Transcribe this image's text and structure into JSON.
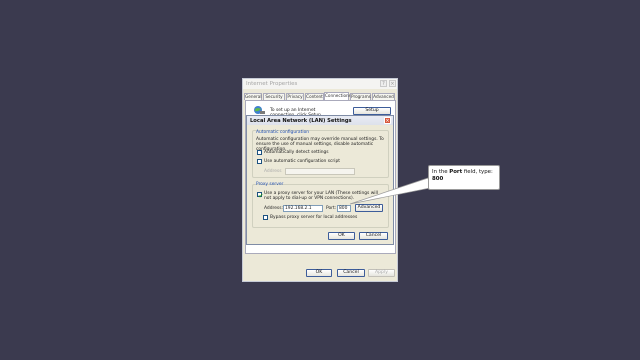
{
  "internet_properties": {
    "title": "Internet Properties",
    "tabs": [
      "General",
      "Security",
      "Privacy",
      "Content",
      "Connections",
      "Programs",
      "Advanced"
    ],
    "active_tab": "Connections",
    "setup_text": "To set up an Internet connection, click Setup.",
    "setup_button": "Setup",
    "ok": "OK",
    "cancel": "Cancel",
    "apply": "Apply",
    "help_glyph": "?",
    "close_glyph": "×"
  },
  "lan_dialog": {
    "title": "Local Area Network (LAN) Settings",
    "auto_config": {
      "label": "Automatic configuration",
      "description": "Automatic configuration may override manual settings. To ensure the use of manual settings, disable automatic configuration.",
      "auto_detect": "Automatically detect settings",
      "use_script": "Use automatic configuration script",
      "address_label": "Address"
    },
    "proxy": {
      "label": "Proxy server",
      "use_proxy": "Use a proxy server for your LAN (These settings will not apply to dial-up or VPN connections).",
      "address_label": "Address:",
      "address_value": "192.168.2.1",
      "port_label": "Port:",
      "port_value": "800",
      "advanced_button": "Advanced",
      "bypass_local": "Bypass proxy server for local addresses"
    },
    "ok": "OK",
    "cancel": "Cancel",
    "close_glyph": "×"
  },
  "callout": {
    "text_before": "In the ",
    "field_name": "Port",
    "text_after": " field, type:",
    "value": "800"
  }
}
